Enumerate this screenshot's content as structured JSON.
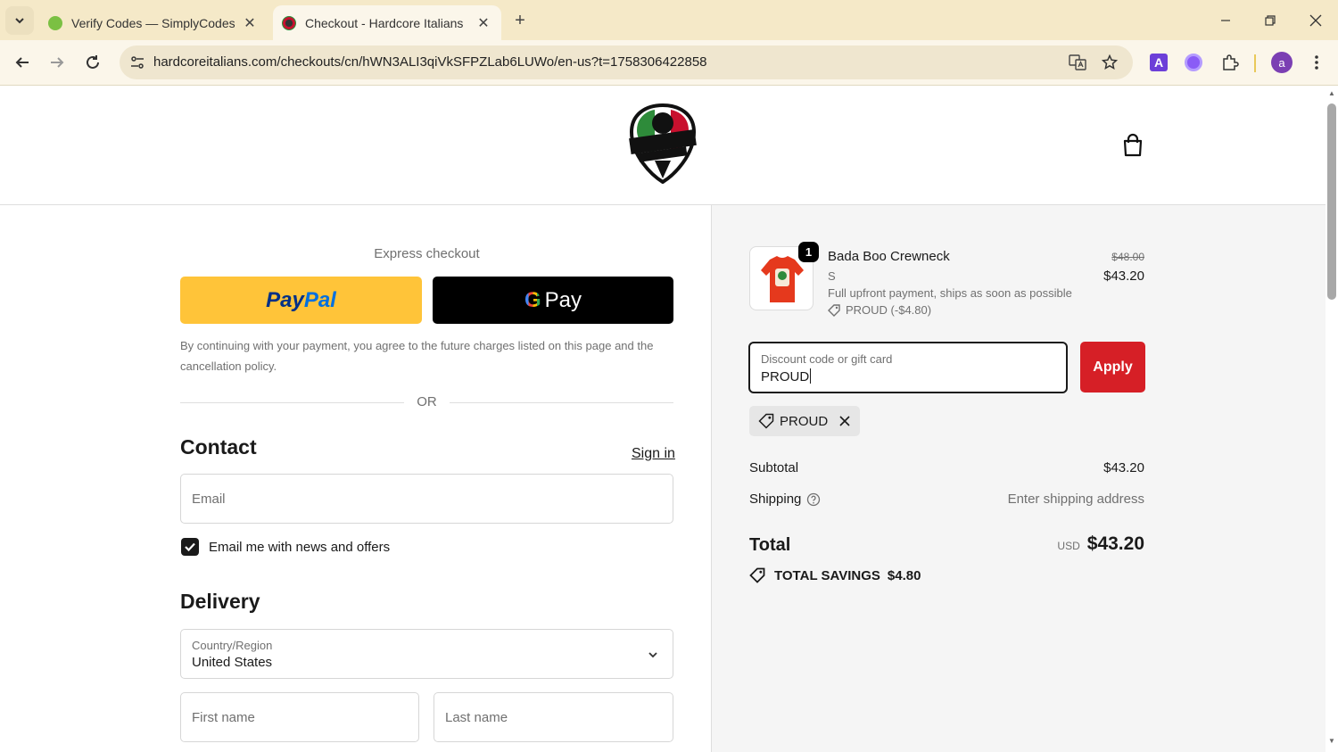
{
  "browser": {
    "tabs": [
      {
        "title": "Verify Codes — SimplyCodes",
        "active": false
      },
      {
        "title": "Checkout - Hardcore Italians",
        "active": true
      }
    ],
    "url": "hardcoreitalians.com/checkouts/cn/hWN3ALI3qiVkSFPZLab6LUWo/en-us?t=1758306422858",
    "profile_initial": "a",
    "extension_letter": "A"
  },
  "checkout": {
    "express_title": "Express checkout",
    "paypal": {
      "pay": "Pay",
      "pal": "Pal"
    },
    "gpay": {
      "g": "G",
      "pay": "Pay"
    },
    "consent_text": "By continuing with your payment, you agree to the future charges listed on this page and the cancellation policy.",
    "or_text": "OR",
    "contact": {
      "heading": "Contact",
      "sign_in": "Sign in",
      "email_placeholder": "Email",
      "newsletter_label": "Email me with news and offers",
      "newsletter_checked": true
    },
    "delivery": {
      "heading": "Delivery",
      "country_label": "Country/Region",
      "country_value": "United States",
      "first_name_placeholder": "First name",
      "last_name_placeholder": "Last name"
    }
  },
  "summary": {
    "product": {
      "quantity": "1",
      "name": "Bada Boo Crewneck",
      "variant": "S",
      "note": "Full upfront payment, ships as soon as possible",
      "discount": "PROUD (-$4.80)",
      "original_price": "$48.00",
      "price": "$43.20"
    },
    "discount_field": {
      "label": "Discount code or gift card",
      "value": "PROUD"
    },
    "apply_label": "Apply",
    "applied_code": "PROUD",
    "subtotal_label": "Subtotal",
    "subtotal_value": "$43.20",
    "shipping_label": "Shipping",
    "shipping_value": "Enter shipping address",
    "total_label": "Total",
    "total_currency": "USD",
    "total_value": "$43.20",
    "savings_label": "TOTAL SAVINGS",
    "savings_value": "$4.80"
  },
  "colors": {
    "apply_button": "#d61f26",
    "paypal_yellow": "#ffc439",
    "tabstrip": "#f5e9c8"
  }
}
